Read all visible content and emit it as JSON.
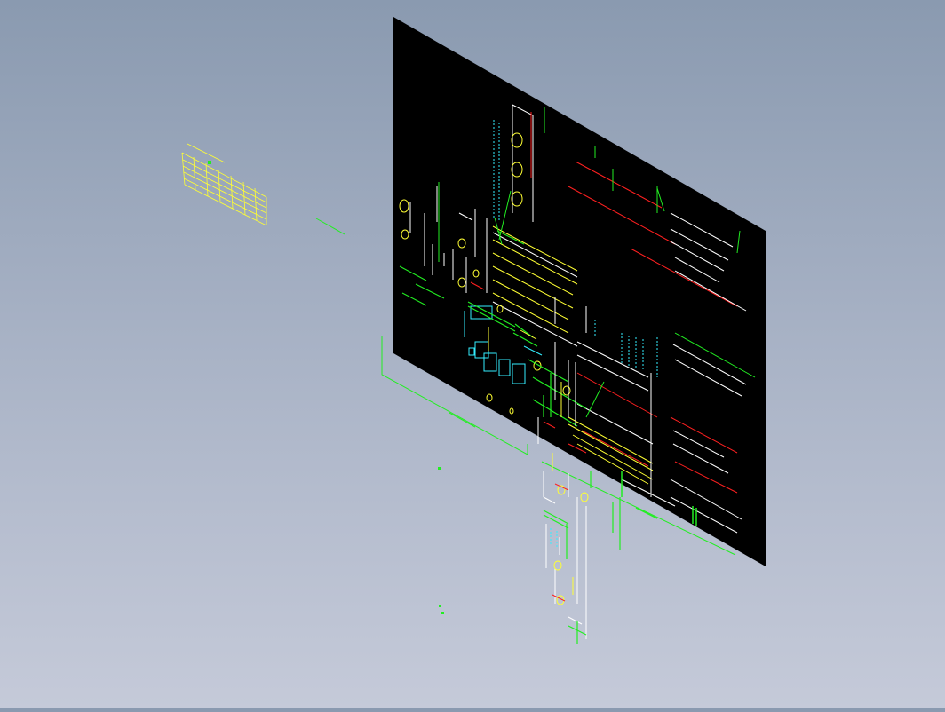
{
  "viewport": {
    "background_top": "#8a9ab0",
    "background_bottom": "#c5cad9"
  },
  "drawing": {
    "sheet_color": "#000000",
    "colors": {
      "red": "#ff2020",
      "yellow": "#ffff33",
      "green": "#22ee22",
      "cyan": "#33eeff",
      "white": "#ffffff"
    }
  },
  "table": {
    "color": "#ffff33"
  }
}
